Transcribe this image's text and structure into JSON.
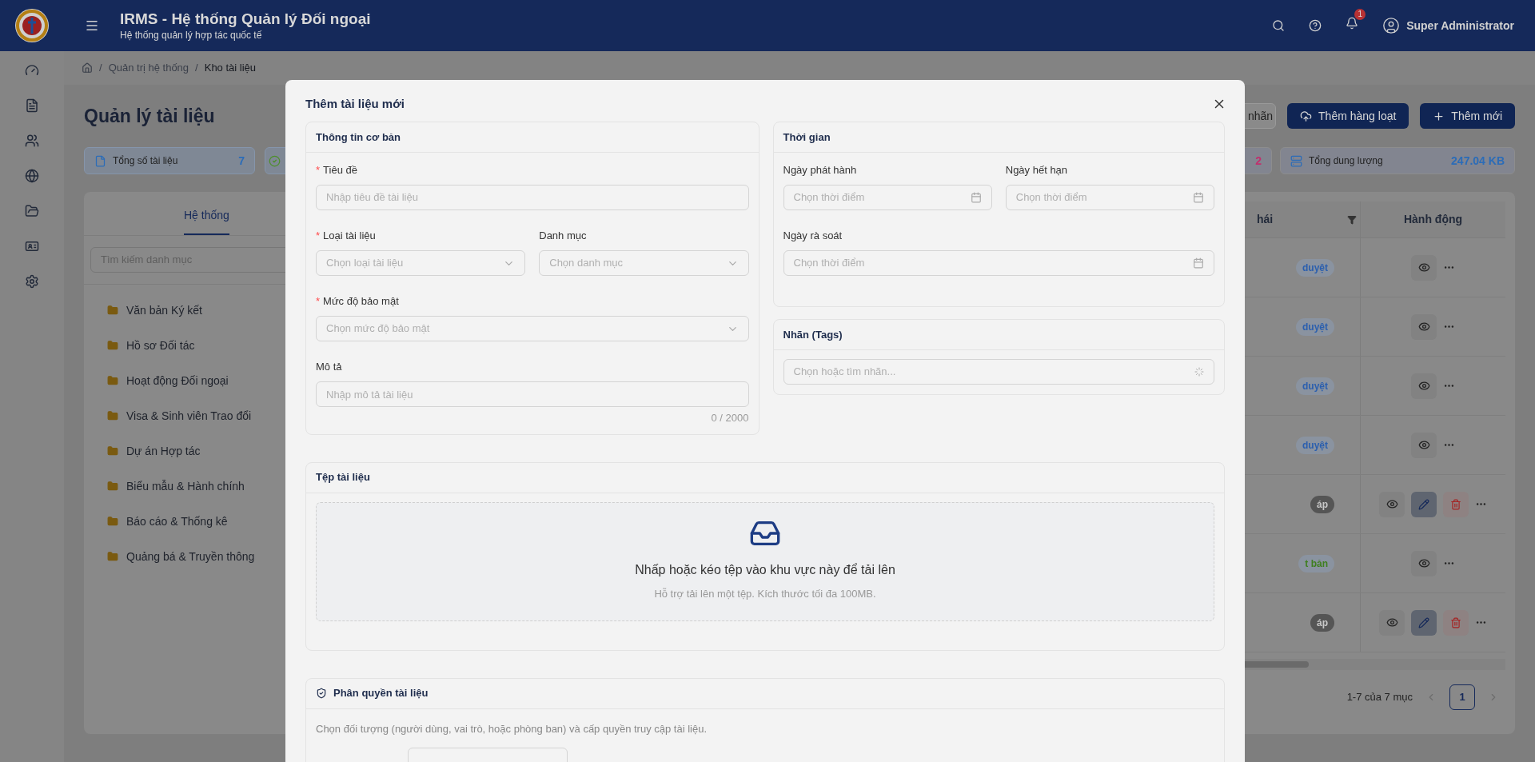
{
  "header": {
    "title": "IRMS - Hệ thống Quản lý Đối ngoại",
    "subtitle": "Hệ thống quản lý hợp tác quốc tế",
    "notifications": "1",
    "user": "Super Administrator"
  },
  "breadcrumb": [
    {
      "label": "/",
      "kind": "separator"
    },
    {
      "label": "Quản trị hệ thống",
      "kind": "link"
    },
    {
      "label": "/",
      "kind": "separator"
    },
    {
      "label": "Kho tài liệu",
      "kind": "current"
    }
  ],
  "page": {
    "title": "Quản lý tài liệu",
    "buttons": [
      {
        "label": "nhãn",
        "kind": "outline"
      },
      {
        "label": "Thêm hàng loạt",
        "kind": "upload"
      },
      {
        "label": "Thêm mới",
        "kind": "add"
      }
    ],
    "stats_left": [
      {
        "label": "Tổng số tài liệu",
        "value": "7",
        "kind": "file",
        "color": "#2b6cb8"
      },
      {
        "kind": "check",
        "color": "#4d8f2a"
      }
    ],
    "stats_right": [
      {
        "value": "2",
        "kind": "plain",
        "color": "#c0306e"
      },
      {
        "label": "Tổng dung lượng",
        "value": "247.04 KB",
        "kind": "storage",
        "color": "#2b6cb8"
      }
    ]
  },
  "categories": {
    "tabs": [
      {
        "label": "Hệ thống",
        "selected": true
      }
    ],
    "search": {
      "placeholder": "Tìm kiếm danh mục"
    },
    "items": [
      {
        "label": "Văn bản Ký kết"
      },
      {
        "label": "Hồ sơ Đối tác"
      },
      {
        "label": "Hoạt động Đối ngoại"
      },
      {
        "label": "Visa & Sinh viên Trao đổi"
      },
      {
        "label": "Dự án Hợp tác"
      },
      {
        "label": "Biểu mẫu & Hành chính"
      },
      {
        "label": "Báo cáo & Thống kê"
      },
      {
        "label": "Quảng bá & Truyền thông"
      }
    ]
  },
  "table": {
    "columns": [
      {
        "label": "hái",
        "filter": true
      },
      {
        "label": "Hành động",
        "filter": false
      }
    ],
    "rows": [
      {
        "status": "duyệt",
        "kind": "soft",
        "color": "#2b5fae",
        "editable": false
      },
      {
        "status": "duyệt",
        "kind": "soft",
        "color": "#2b5fae",
        "editable": false
      },
      {
        "status": "duyệt",
        "kind": "soft",
        "color": "#2b5fae",
        "editable": false
      },
      {
        "status": "duyệt",
        "kind": "soft",
        "color": "#2b5fae",
        "editable": false
      },
      {
        "status": "áp",
        "kind": "filled",
        "color": "#555555",
        "editable": true
      },
      {
        "status": "t bản",
        "kind": "soft",
        "color": "#3f7f1f",
        "editable": false
      },
      {
        "status": "áp",
        "kind": "filled",
        "color": "#555555",
        "editable": true
      }
    ],
    "pagination": {
      "summary": "1-7 của 7 mục",
      "pages": [
        {
          "label": "1",
          "selected": true
        }
      ]
    }
  },
  "modal": {
    "title": "Thêm tài liệu mới",
    "basic": {
      "title": "Thông tin cơ bản",
      "rows": [
        [
          {
            "label": "Tiêu đề",
            "mark": "*",
            "placeholder": "Nhập tiêu đề tài liệu",
            "kind": "text"
          }
        ],
        [
          {
            "label": "Loại tài liệu",
            "mark": "*",
            "placeholder": "Chọn loại tài liệu",
            "kind": "select"
          },
          {
            "label": "Danh mục",
            "placeholder": "Chọn danh mục",
            "kind": "select"
          }
        ],
        [
          {
            "label": "Mức độ bảo mật",
            "mark": "*",
            "placeholder": "Chọn mức độ bảo mật",
            "kind": "select"
          }
        ],
        [
          {
            "label": "Mô tả",
            "placeholder": "Nhập mô tả tài liệu",
            "kind": "textarea",
            "counter": "0 / 2000"
          }
        ]
      ]
    },
    "time": {
      "title": "Thời gian",
      "rows": [
        [
          {
            "label": "Ngày phát hành",
            "placeholder": "Chọn thời điểm",
            "kind": "date"
          },
          {
            "label": "Ngày hết hạn",
            "placeholder": "Chọn thời điểm",
            "kind": "date"
          }
        ],
        [
          {
            "label": "Ngày rà soát",
            "placeholder": "Chọn thời điểm",
            "kind": "date"
          }
        ]
      ]
    },
    "tags": {
      "title": "Nhãn (Tags)",
      "placeholder": "Chọn hoặc tìm nhãn..."
    },
    "upload": {
      "title": "Tệp tài liệu",
      "text": "Nhấp hoặc kéo tệp vào khu vực này để tải lên",
      "hint": "Hỗ trợ tải lên một tệp. Kích thước tối đa 100MB."
    },
    "permissions": {
      "title": "Phân quyền tài liệu",
      "description": "Chọn đối tượng (người dùng, vai trò, hoặc phòng ban) và cấp quyền truy cập tài liệu."
    }
  }
}
